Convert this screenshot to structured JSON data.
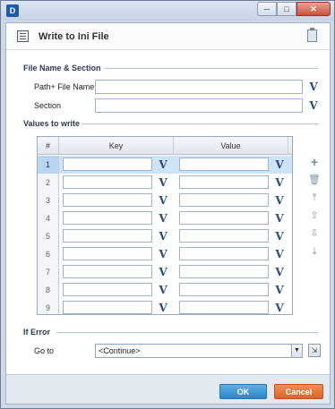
{
  "window": {
    "app_icon": "D",
    "minimize": "─",
    "maximize": "□",
    "close": "✕"
  },
  "header": {
    "title": "Write to Ini File",
    "icon": "list-icon",
    "clipboard_icon": "clipboard-icon"
  },
  "file_section": {
    "title": "File Name & Section",
    "path_label": "Path+ File Name",
    "path_value": "",
    "section_label": "Section",
    "section_value": "",
    "variable_button": "V"
  },
  "values_section": {
    "title": "Values to write",
    "columns": {
      "num": "#",
      "key": "Key",
      "value": "Value"
    },
    "rows": [
      {
        "num": "1",
        "key": "",
        "value": ""
      },
      {
        "num": "2",
        "key": "",
        "value": ""
      },
      {
        "num": "3",
        "key": "",
        "value": ""
      },
      {
        "num": "4",
        "key": "",
        "value": ""
      },
      {
        "num": "5",
        "key": "",
        "value": ""
      },
      {
        "num": "6",
        "key": "",
        "value": ""
      },
      {
        "num": "7",
        "key": "",
        "value": ""
      },
      {
        "num": "8",
        "key": "",
        "value": ""
      },
      {
        "num": "9",
        "key": "",
        "value": ""
      }
    ],
    "selected_row": 1,
    "tools": [
      "add-icon",
      "delete-icon",
      "move-top-icon",
      "move-up-icon",
      "move-down-icon",
      "move-bottom-icon"
    ]
  },
  "error_section": {
    "title": "If Error",
    "goto_label": "Go to",
    "goto_value": "<Continue>"
  },
  "footer": {
    "ok_label": "OK",
    "cancel_label": "Cancel"
  },
  "colors": {
    "ok": "#2e86c9",
    "cancel": "#d9652a",
    "selected_row": "#cfe3f7"
  }
}
